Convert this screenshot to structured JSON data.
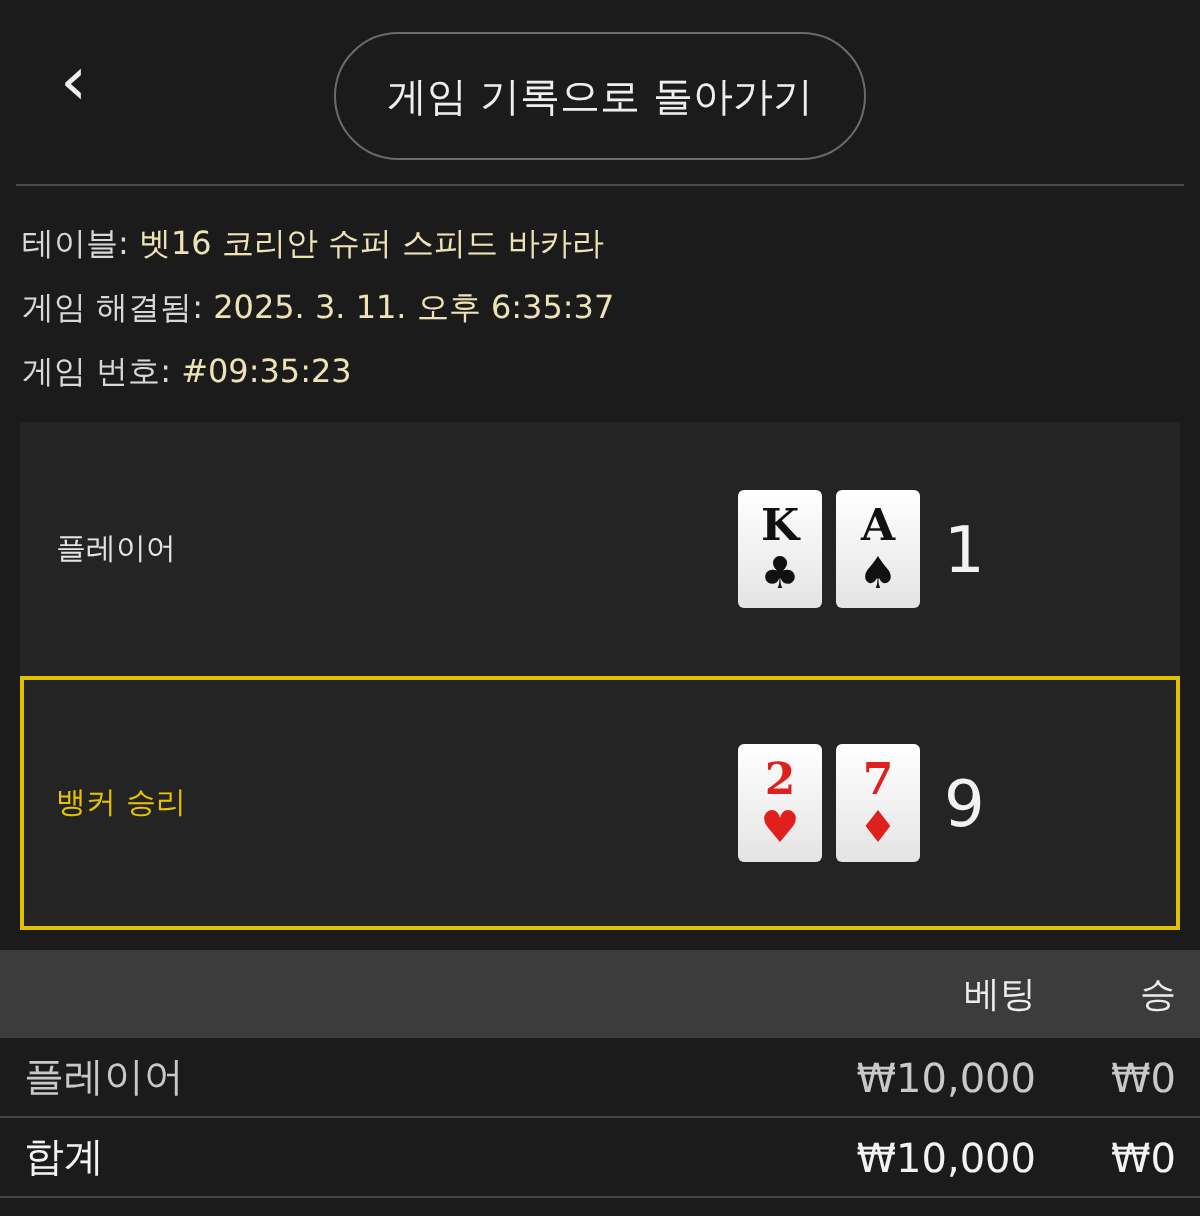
{
  "header": {
    "back_icon": "‹",
    "button": "게임 기록으로 돌아가기"
  },
  "info": [
    {
      "label": "테이블:",
      "value": "벳16 코리안 슈퍼 스피드 바카라"
    },
    {
      "label": "게임 해결됨:",
      "value": "2025. 3. 11. 오후 6:35:37"
    },
    {
      "label": "게임 번호:",
      "value": "#09:35:23"
    }
  ],
  "hands": [
    {
      "label": "플레이어",
      "winner": false,
      "score": "1",
      "cards": [
        {
          "rank": "K",
          "suit": "♣",
          "color": "#111111"
        },
        {
          "rank": "A",
          "suit": "♠",
          "color": "#111111"
        }
      ]
    },
    {
      "label": "뱅커 승리",
      "winner": true,
      "score": "9",
      "cards": [
        {
          "rank": "2",
          "suit": "♥",
          "color": "#e0201c"
        },
        {
          "rank": "7",
          "suit": "♦",
          "color": "#e0201c"
        }
      ]
    }
  ],
  "table": {
    "columns": [
      "베팅",
      "승"
    ],
    "rows": [
      {
        "name": "플레이어",
        "bet": "₩10,000",
        "win": "₩0"
      },
      {
        "name": "합계",
        "bet": "₩10,000",
        "win": "₩0"
      }
    ]
  }
}
